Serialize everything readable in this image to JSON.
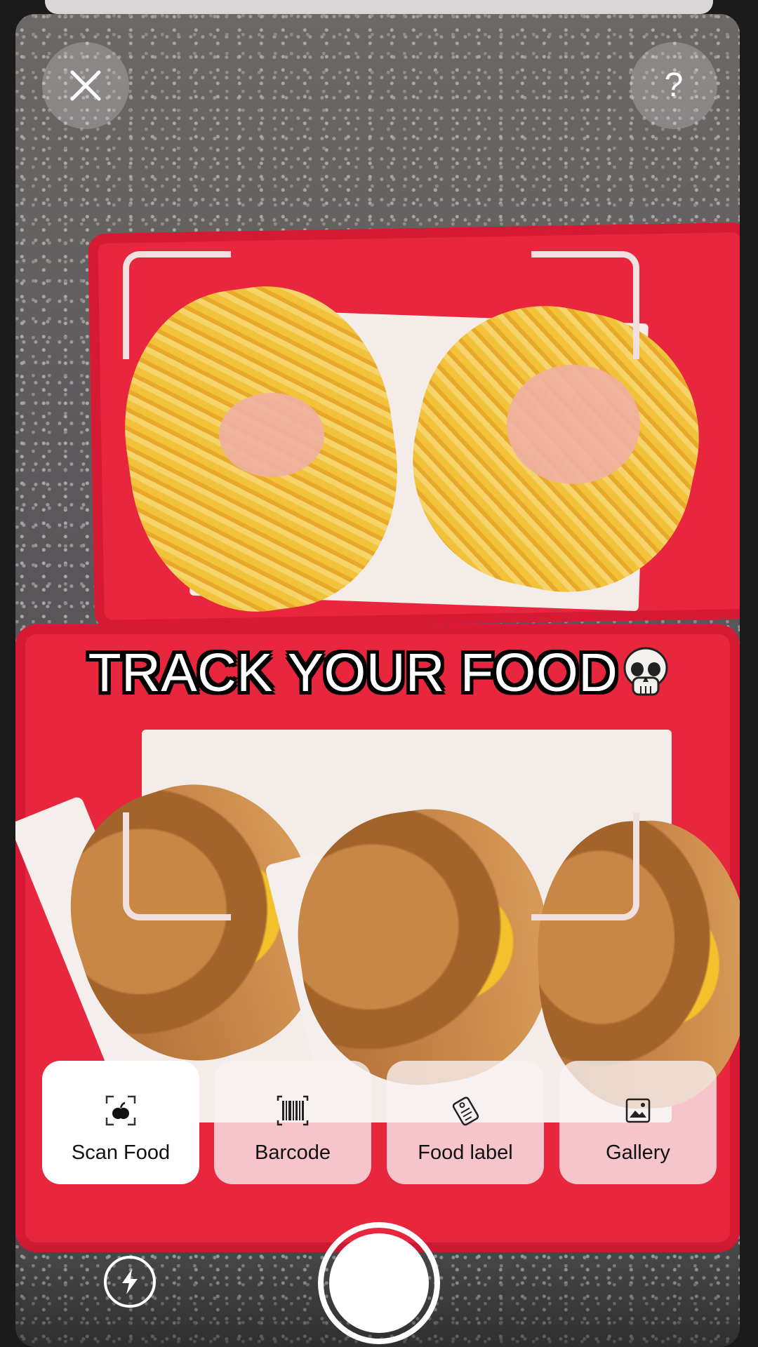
{
  "overlay": {
    "caption_text": "TRACK YOUR FOOD",
    "caption_emoji": "skull"
  },
  "top_bar": {
    "close_icon": "close-icon",
    "help_icon": "help-icon",
    "help_glyph": "?"
  },
  "modes": {
    "items": [
      {
        "label": "Scan Food",
        "icon": "scan-food-icon",
        "active": true
      },
      {
        "label": "Barcode",
        "icon": "barcode-icon",
        "active": false
      },
      {
        "label": "Food label",
        "icon": "food-label-icon",
        "active": false
      },
      {
        "label": "Gallery",
        "icon": "gallery-icon",
        "active": false
      }
    ]
  },
  "camera_controls": {
    "flash_icon": "flash-icon",
    "shutter": "shutter-button"
  },
  "colors": {
    "accent_white": "#ffffff",
    "tray_red": "#e8263d",
    "frame_corner": "#f2dfe0"
  }
}
